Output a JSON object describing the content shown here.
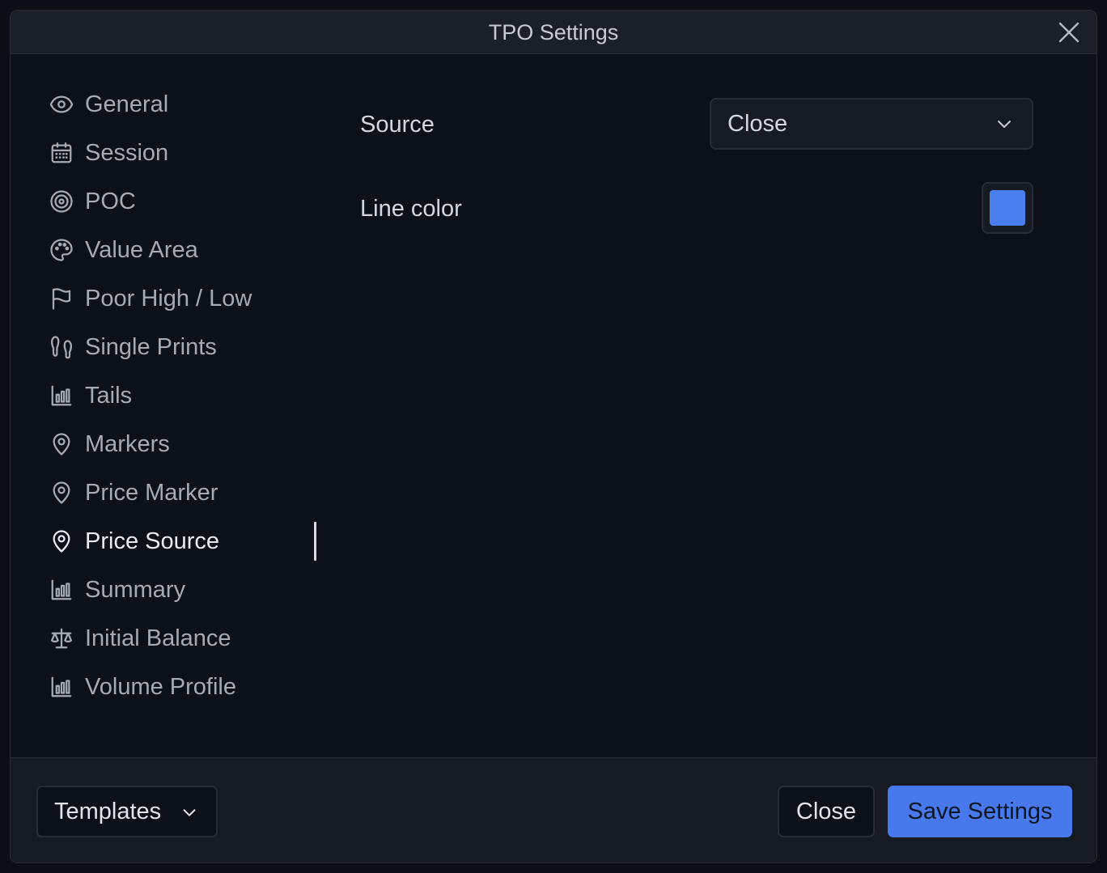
{
  "dialog": {
    "title": "TPO Settings"
  },
  "sidebar": {
    "items": [
      {
        "label": "General",
        "icon": "eye-icon"
      },
      {
        "label": "Session",
        "icon": "calendar-icon"
      },
      {
        "label": "POC",
        "icon": "target-icon"
      },
      {
        "label": "Value Area",
        "icon": "palette-icon"
      },
      {
        "label": "Poor High / Low",
        "icon": "flag-icon"
      },
      {
        "label": "Single Prints",
        "icon": "footprints-icon"
      },
      {
        "label": "Tails",
        "icon": "bar-chart-icon"
      },
      {
        "label": "Markers",
        "icon": "map-pin-icon"
      },
      {
        "label": "Price Marker",
        "icon": "map-pin-icon"
      },
      {
        "label": "Price Source",
        "icon": "map-pin-icon",
        "active": true
      },
      {
        "label": "Summary",
        "icon": "bar-chart-icon"
      },
      {
        "label": "Initial Balance",
        "icon": "scale-icon"
      },
      {
        "label": "Volume Profile",
        "icon": "bar-chart-icon"
      }
    ]
  },
  "settings": {
    "source_label": "Source",
    "source_value": "Close",
    "line_color_label": "Line color",
    "line_color_value": "#4a7ff0"
  },
  "footer": {
    "templates_label": "Templates",
    "close_label": "Close",
    "save_label": "Save Settings"
  },
  "colors": {
    "accent": "#4779ec",
    "background": "#0c1019",
    "panel": "#1b1f29"
  }
}
